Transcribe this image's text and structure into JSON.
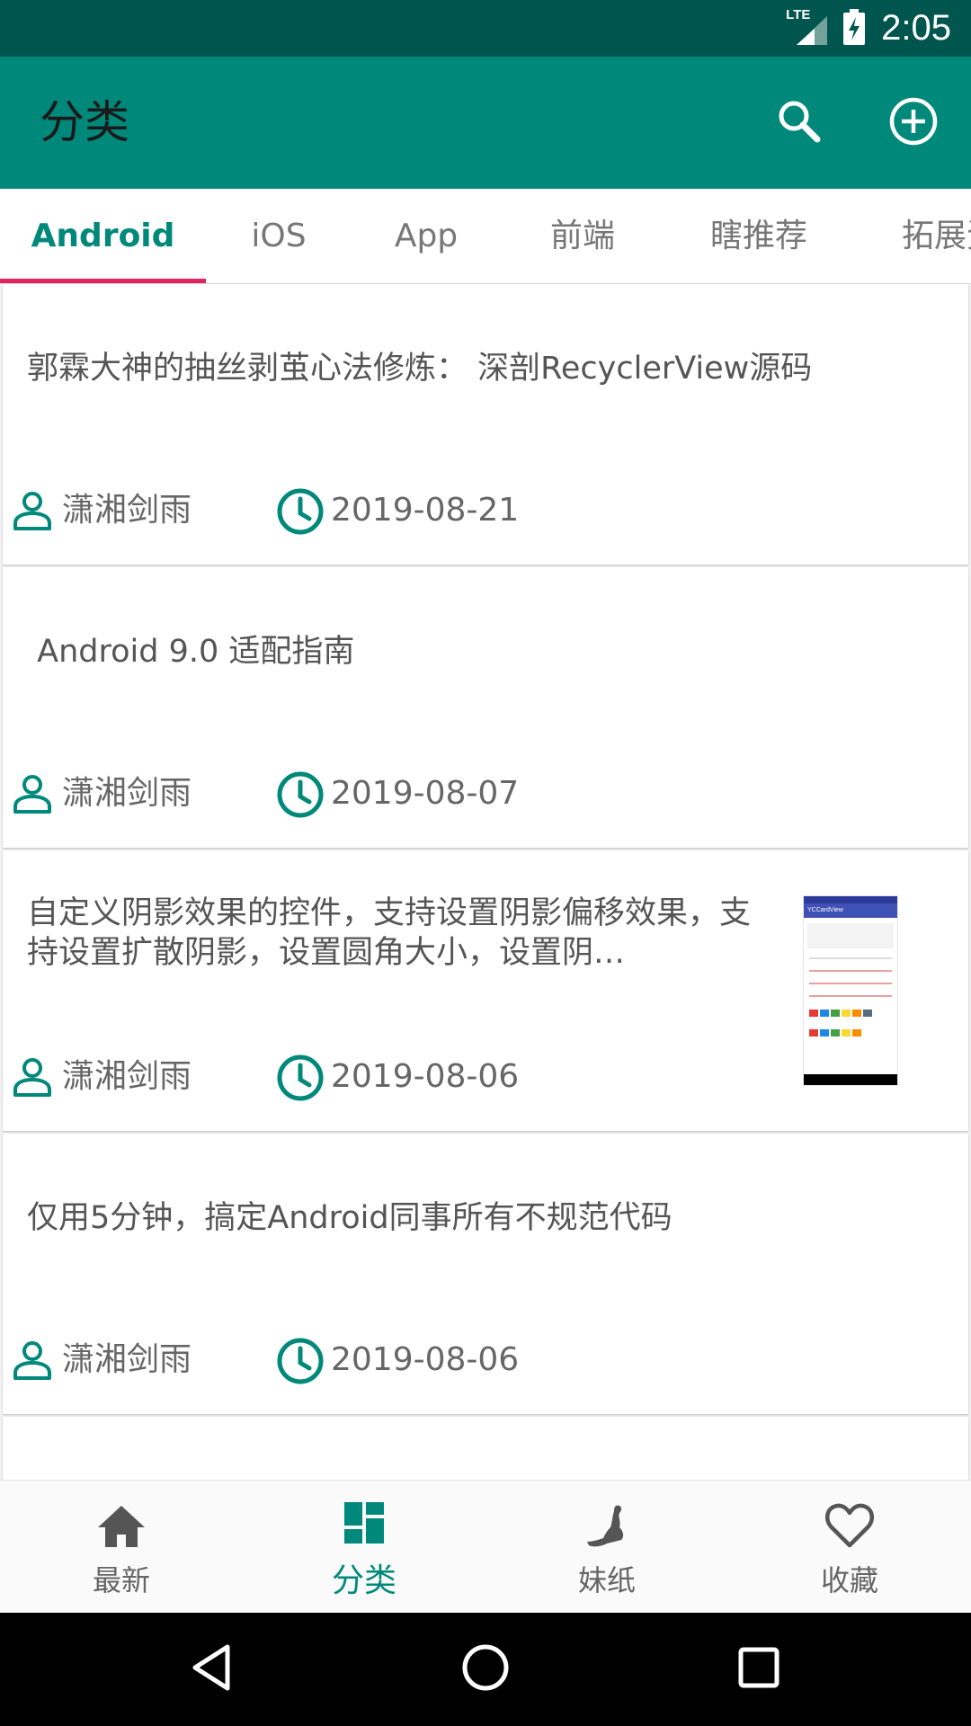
{
  "status_bar": {
    "network": "LTE",
    "time": "2:05"
  },
  "app_bar": {
    "title": "分类",
    "search_icon": "search-icon",
    "add_icon": "add-circle-icon"
  },
  "tabs": [
    {
      "label": "Android",
      "active": true
    },
    {
      "label": "iOS"
    },
    {
      "label": "App"
    },
    {
      "label": "前端"
    },
    {
      "label": "瞎推荐"
    },
    {
      "label": "拓展资源"
    }
  ],
  "articles": [
    {
      "title": "郭霖大神的抽丝剥茧心法修炼： 深剖RecyclerView源码",
      "author": "潇湘剑雨",
      "date": "2019-08-21"
    },
    {
      "title": " Android 9.0 适配指南",
      "author": "潇湘剑雨",
      "date": "2019-08-07"
    },
    {
      "title": "自定义阴影效果的控件，支持设置阴影偏移效果，支持设置扩散阴影，设置圆角大小，设置阴…",
      "author": "潇湘剑雨",
      "date": "2019-08-06",
      "thumbnail": {
        "app_bar_text": "YCCardView"
      }
    },
    {
      "title": "仅用5分钟，搞定Android同事所有不规范代码",
      "author": "潇湘剑雨",
      "date": "2019-08-06"
    }
  ],
  "bottom_nav": [
    {
      "label": "最新",
      "icon": "home-icon"
    },
    {
      "label": "分类",
      "icon": "dashboard-icon",
      "active": true
    },
    {
      "label": "妹纸",
      "icon": "silhouette-icon"
    },
    {
      "label": "收藏",
      "icon": "heart-icon"
    }
  ],
  "colors": {
    "primary": "#00897b",
    "primary_dark": "#00564e",
    "tab_indicator": "#e0245e"
  }
}
